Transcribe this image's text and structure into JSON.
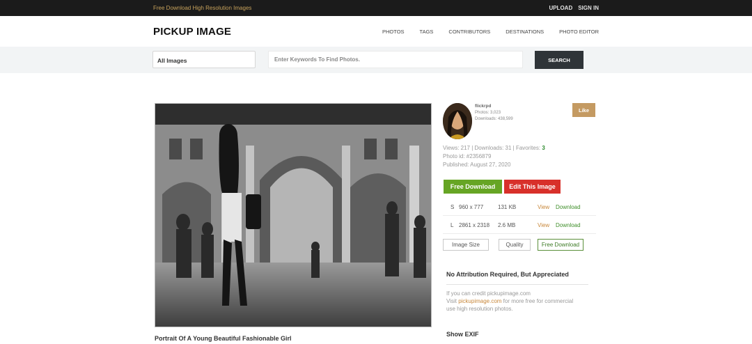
{
  "topbar": {
    "tagline": "Free Download High Resolution Images",
    "upload": "UPLOAD",
    "signin": "SIGN IN"
  },
  "header": {
    "logo": "PICKUP IMAGE",
    "nav": [
      "PHOTOS",
      "TAGS",
      "CONTRIBUTORS",
      "DESTINATIONS",
      "PHOTO EDITOR"
    ]
  },
  "search": {
    "category": "All Images",
    "placeholder": "Enter Keywords To Find Photos.",
    "button": "SEARCH"
  },
  "photo": {
    "caption": "Portrait Of A Young Beautiful Fashionable Girl"
  },
  "author": {
    "name": "flickrpd",
    "photos": "Photos: 3,023",
    "downloads": "Downloads: 438,599",
    "like": "Like"
  },
  "stats": {
    "views_line": "Views: 217 | Downloads: 31 | Favorites:",
    "favorites": "3",
    "photo_id": "Photo id: #2356879",
    "published": "Published: August 27, 2020"
  },
  "actions": {
    "free_download": "Free Download",
    "edit": "Edit This Image"
  },
  "sizes": [
    {
      "code": "S",
      "dims": "960 x 777",
      "size": "131 KB",
      "view": "View",
      "download": "Download"
    },
    {
      "code": "L",
      "dims": "2861 x 2318",
      "size": "2.6 MB",
      "view": "View",
      "download": "Download"
    }
  ],
  "options": {
    "image_size": "Image Size",
    "quality": "Quality",
    "free_download": "Free Download"
  },
  "attribution": {
    "title": "No Attribution Required, But Appreciated",
    "line1": "If you can credit pickupimage.com",
    "line2_pre": "Visit ",
    "line2_link": "pickupimage.com",
    "line2_post": " for more free for commercial",
    "line3": "use high resolution photos."
  },
  "exif": "Show EXIF"
}
